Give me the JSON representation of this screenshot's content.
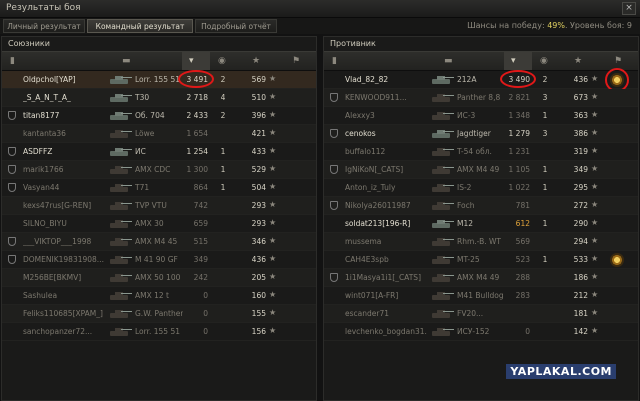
{
  "window": {
    "title": "Результаты боя",
    "close_icon": "×"
  },
  "tabs": [
    {
      "label": "Личный результат",
      "active": false
    },
    {
      "label": "Командный результат",
      "active": true
    },
    {
      "label": "Подробный отчёт",
      "active": false
    }
  ],
  "status": {
    "prefix": "Шансы на победу: ",
    "win_chance": "49%",
    "suffix": ". Уровень боя: 9"
  },
  "watermark": "YAPLAKAL.COM",
  "allies": {
    "title": "Союзники",
    "rows": [
      {
        "player": "Oldpchol[YAP]",
        "tank": "Lorr. 155 51",
        "damage": "3 491",
        "kills": "2",
        "xp": "569",
        "medal": false,
        "alive": true,
        "damage_style": "normal",
        "highlight": true,
        "circled": true
      },
      {
        "player": "_S_A_N_T_A_",
        "tank": "T30",
        "damage": "2 718",
        "kills": "4",
        "xp": "510",
        "medal": false,
        "alive": true,
        "damage_style": "normal"
      },
      {
        "player": "titan8177",
        "tank": "Об. 704",
        "damage": "2 433",
        "kills": "2",
        "xp": "396",
        "medal": true,
        "alive": true,
        "damage_style": "normal"
      },
      {
        "player": "kantanta36",
        "tank": "Löwe",
        "damage": "1 654",
        "kills": "",
        "xp": "421",
        "medal": false,
        "alive": false,
        "damage_style": "grey"
      },
      {
        "player": "ASDFFZ",
        "tank": "ИС",
        "damage": "1 254",
        "kills": "1",
        "xp": "433",
        "medal": true,
        "alive": true,
        "damage_style": "normal"
      },
      {
        "player": "marik1766",
        "tank": "AMX CDC",
        "damage": "1 300",
        "kills": "1",
        "xp": "529",
        "medal": true,
        "alive": false,
        "damage_style": "grey"
      },
      {
        "player": "Vasyan44",
        "tank": "T71",
        "damage": "864",
        "kills": "1",
        "xp": "504",
        "medal": true,
        "alive": false,
        "damage_style": "grey"
      },
      {
        "player": "kexs47rus[G-REN]",
        "tank": "TVP VTU",
        "damage": "742",
        "kills": "",
        "xp": "293",
        "medal": false,
        "alive": false,
        "damage_style": "grey"
      },
      {
        "player": "SILNO_BIYU",
        "tank": "AMX 30",
        "damage": "659",
        "kills": "",
        "xp": "293",
        "medal": false,
        "alive": false,
        "damage_style": "grey"
      },
      {
        "player": "___VIKTOP___1998",
        "tank": "AMX M4 45",
        "damage": "515",
        "kills": "",
        "xp": "346",
        "medal": true,
        "alive": false,
        "damage_style": "grey"
      },
      {
        "player": "DOMENIK19831908...",
        "tank": "M 41 90 GF",
        "damage": "349",
        "kills": "",
        "xp": "436",
        "medal": true,
        "alive": false,
        "damage_style": "grey"
      },
      {
        "player": "M256BE[BKMV]",
        "tank": "AMX 50 100",
        "damage": "242",
        "kills": "",
        "xp": "205",
        "medal": false,
        "alive": false,
        "damage_style": "grey"
      },
      {
        "player": "Sashulea",
        "tank": "AMX 12 t",
        "damage": "0",
        "kills": "",
        "xp": "160",
        "medal": false,
        "alive": false,
        "damage_style": "grey"
      },
      {
        "player": "Feliks110685[XPAM_]",
        "tank": "G.W. Panther",
        "damage": "0",
        "kills": "",
        "xp": "155",
        "medal": false,
        "alive": false,
        "damage_style": "grey"
      },
      {
        "player": "sanchopanzer72...",
        "tank": "Lorr. 155 51",
        "damage": "0",
        "kills": "",
        "xp": "156",
        "medal": false,
        "alive": false,
        "damage_style": "grey"
      }
    ]
  },
  "enemies": {
    "title": "Противник",
    "rows": [
      {
        "player": "Vlad_82_82",
        "tank": "212A",
        "damage": "3 490",
        "kills": "2",
        "xp": "436",
        "medal": false,
        "alive": true,
        "damage_style": "normal",
        "circled": true,
        "achievement": true,
        "achievement_circled": true
      },
      {
        "player": "KENWOOD911...",
        "tank": "Panther 8,8",
        "damage": "2 821",
        "kills": "3",
        "xp": "673",
        "medal": true,
        "alive": false,
        "damage_style": "grey"
      },
      {
        "player": "Alexxy3",
        "tank": "ИС-3",
        "damage": "1 348",
        "kills": "1",
        "xp": "363",
        "medal": false,
        "alive": false,
        "damage_style": "grey"
      },
      {
        "player": "cenokos",
        "tank": "Jagdtiger",
        "damage": "1 279",
        "kills": "3",
        "xp": "386",
        "medal": true,
        "alive": true,
        "damage_style": "normal"
      },
      {
        "player": "buffalo112",
        "tank": "T-54 обл.",
        "damage": "1 231",
        "kills": "",
        "xp": "319",
        "medal": false,
        "alive": false,
        "damage_style": "grey"
      },
      {
        "player": "IgNiKoN[_CATS]",
        "tank": "AMX M4 49",
        "damage": "1 105",
        "kills": "1",
        "xp": "349",
        "medal": true,
        "alive": false,
        "damage_style": "grey"
      },
      {
        "player": "Anton_iz_Tuly",
        "tank": "IS-2",
        "damage": "1 022",
        "kills": "1",
        "xp": "295",
        "medal": false,
        "alive": false,
        "damage_style": "grey"
      },
      {
        "player": "Nikolya26011987",
        "tank": "Foch",
        "damage": "781",
        "kills": "",
        "xp": "272",
        "medal": true,
        "alive": false,
        "damage_style": "grey"
      },
      {
        "player": "soldat213[196-R]",
        "tank": "M12",
        "damage": "612",
        "kills": "1",
        "xp": "290",
        "medal": false,
        "alive": true,
        "damage_style": "orange"
      },
      {
        "player": "mussema",
        "tank": "Rhm.-B. WT",
        "damage": "569",
        "kills": "",
        "xp": "294",
        "medal": false,
        "alive": false,
        "damage_style": "grey"
      },
      {
        "player": "CAH4E3spb",
        "tank": "MT-25",
        "damage": "523",
        "kills": "1",
        "xp": "533",
        "medal": false,
        "alive": false,
        "damage_style": "grey",
        "achievement": true
      },
      {
        "player": "1i1Masya1i1[_CATS]",
        "tank": "AMX M4 49",
        "damage": "288",
        "kills": "",
        "xp": "186",
        "medal": true,
        "alive": false,
        "damage_style": "grey"
      },
      {
        "player": "wint071[A-FR]",
        "tank": "M41 Bulldog",
        "damage": "283",
        "kills": "",
        "xp": "212",
        "medal": false,
        "alive": false,
        "damage_style": "grey"
      },
      {
        "player": "escander71",
        "tank": "FV20...",
        "damage": "",
        "kills": "",
        "xp": "181",
        "medal": false,
        "alive": false,
        "damage_style": "grey"
      },
      {
        "player": "levchenko_bogdan31...",
        "tank": "ИСУ-152",
        "damage": "0",
        "kills": "",
        "xp": "142",
        "medal": false,
        "alive": false,
        "damage_style": "grey"
      }
    ]
  },
  "column_icons": [
    "platoon-icon",
    "tank-icon",
    "damage-icon",
    "kills-icon",
    "xp-icon",
    "achievement-icon"
  ],
  "colors": {
    "highlight_row": "#33291f",
    "annotation": "#e01818",
    "win_chance": "#e0d060",
    "damage_orange": "#e0a33a"
  }
}
